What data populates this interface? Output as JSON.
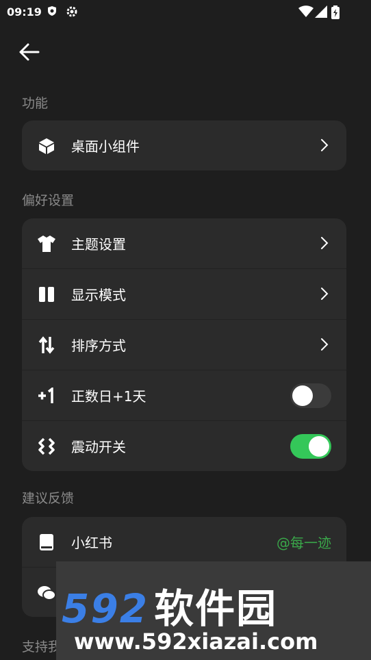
{
  "status_bar": {
    "time": "09:19"
  },
  "sections": {
    "features": {
      "title": "功能",
      "items": [
        {
          "label": "桌面小组件"
        }
      ]
    },
    "preferences": {
      "title": "偏好设置",
      "items": [
        {
          "label": "主题设置"
        },
        {
          "label": "显示模式"
        },
        {
          "label": "排序方式"
        },
        {
          "label": "正数日+1天",
          "toggle": "off"
        },
        {
          "label": "震动开关",
          "toggle": "on"
        }
      ]
    },
    "feedback": {
      "title": "建议反馈",
      "items": [
        {
          "label": "小红书",
          "value": "@每一迹"
        }
      ]
    },
    "support": {
      "title": "支持我"
    }
  },
  "watermark": {
    "brand_digits": "592",
    "brand_cn": "软件园",
    "url": "www.592xiazai.com"
  },
  "colors": {
    "background": "#1e1e1e",
    "card": "#2b2b2b",
    "toggle_on": "#34c759",
    "accent_green": "#3aa84a",
    "section_text": "#8a8a8a"
  }
}
